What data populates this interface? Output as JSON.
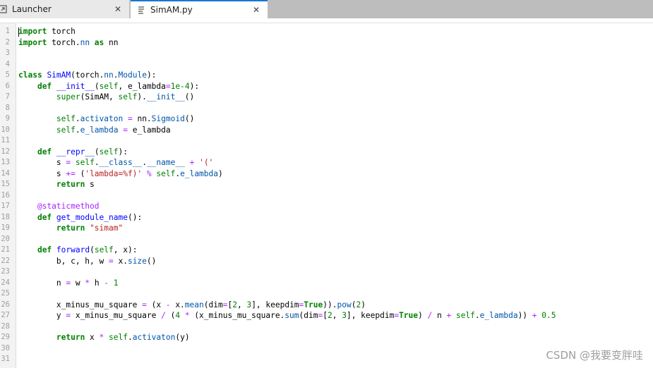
{
  "tabs": [
    {
      "label": "Launcher",
      "icon": "launcher-icon"
    },
    {
      "label": "SimAM.py",
      "icon": "file-text-icon"
    }
  ],
  "close_glyph": "✕",
  "watermark": "CSDN @我要变胖哇",
  "lines": [
    {
      "n": "1",
      "t": [
        [
          "kw",
          "import"
        ],
        [
          "",
          " torch"
        ]
      ]
    },
    {
      "n": "2",
      "t": [
        [
          "kw",
          "import"
        ],
        [
          "",
          " torch."
        ],
        [
          "at",
          "nn"
        ],
        [
          "",
          ""
        ],
        [
          "kw",
          " as"
        ],
        [
          "",
          " nn"
        ]
      ]
    },
    {
      "n": "3",
      "t": []
    },
    {
      "n": "4",
      "t": []
    },
    {
      "n": "5",
      "t": [
        [
          "kw",
          "class"
        ],
        [
          "",
          " "
        ],
        [
          "nm",
          "SimAM"
        ],
        [
          "",
          "(torch."
        ],
        [
          "at",
          "nn"
        ],
        [
          "",
          "."
        ],
        [
          "at",
          "Module"
        ],
        [
          "",
          "):"
        ]
      ]
    },
    {
      "n": "6",
      "t": [
        [
          "",
          "    "
        ],
        [
          "kw",
          "def"
        ],
        [
          "",
          " "
        ],
        [
          "nm",
          "__init__"
        ],
        [
          "",
          "("
        ],
        [
          "bi",
          "self"
        ],
        [
          "",
          ", e_lambda"
        ],
        [
          "op",
          "="
        ],
        [
          "nu",
          "1e-4"
        ],
        [
          "",
          "):"
        ]
      ]
    },
    {
      "n": "7",
      "t": [
        [
          "",
          "        "
        ],
        [
          "bi",
          "super"
        ],
        [
          "",
          "(SimAM, "
        ],
        [
          "bi",
          "self"
        ],
        [
          "",
          ")."
        ],
        [
          "at",
          "__init__"
        ],
        [
          "",
          "()"
        ]
      ]
    },
    {
      "n": "8",
      "t": []
    },
    {
      "n": "9",
      "t": [
        [
          "",
          "        "
        ],
        [
          "bi",
          "self"
        ],
        [
          "",
          "."
        ],
        [
          "at",
          "activaton"
        ],
        [
          "",
          " "
        ],
        [
          "op",
          "="
        ],
        [
          "",
          " nn."
        ],
        [
          "at",
          "Sigmoid"
        ],
        [
          "",
          "()"
        ]
      ]
    },
    {
      "n": "10",
      "t": [
        [
          "",
          "        "
        ],
        [
          "bi",
          "self"
        ],
        [
          "",
          "."
        ],
        [
          "at",
          "e_lambda"
        ],
        [
          "",
          " "
        ],
        [
          "op",
          "="
        ],
        [
          "",
          " e_lambda"
        ]
      ]
    },
    {
      "n": "11",
      "t": []
    },
    {
      "n": "12",
      "t": [
        [
          "",
          "    "
        ],
        [
          "kw",
          "def"
        ],
        [
          "",
          " "
        ],
        [
          "nm",
          "__repr__"
        ],
        [
          "",
          "("
        ],
        [
          "bi",
          "self"
        ],
        [
          "",
          "):"
        ]
      ]
    },
    {
      "n": "13",
      "t": [
        [
          "",
          "        s "
        ],
        [
          "op",
          "="
        ],
        [
          "",
          " "
        ],
        [
          "bi",
          "self"
        ],
        [
          "",
          "."
        ],
        [
          "at",
          "__class__"
        ],
        [
          "",
          "."
        ],
        [
          "at",
          "__name__"
        ],
        [
          "",
          " "
        ],
        [
          "op",
          "+"
        ],
        [
          "",
          " "
        ],
        [
          "st",
          "'('"
        ]
      ]
    },
    {
      "n": "14",
      "t": [
        [
          "",
          "        s "
        ],
        [
          "op",
          "+="
        ],
        [
          "",
          " ("
        ],
        [
          "st",
          "'lambda=%f)'"
        ],
        [
          "",
          " "
        ],
        [
          "op",
          "%"
        ],
        [
          "",
          " "
        ],
        [
          "bi",
          "self"
        ],
        [
          "",
          "."
        ],
        [
          "at",
          "e_lambda"
        ],
        [
          "",
          ")"
        ]
      ]
    },
    {
      "n": "15",
      "t": [
        [
          "",
          "        "
        ],
        [
          "kw",
          "return"
        ],
        [
          "",
          " s"
        ]
      ]
    },
    {
      "n": "16",
      "t": []
    },
    {
      "n": "17",
      "t": [
        [
          "",
          "    "
        ],
        [
          "dec",
          "@staticmethod"
        ]
      ]
    },
    {
      "n": "18",
      "t": [
        [
          "",
          "    "
        ],
        [
          "kw",
          "def"
        ],
        [
          "",
          " "
        ],
        [
          "nm",
          "get_module_name"
        ],
        [
          "",
          "():"
        ]
      ]
    },
    {
      "n": "19",
      "t": [
        [
          "",
          "        "
        ],
        [
          "kw",
          "return"
        ],
        [
          "",
          " "
        ],
        [
          "st",
          "\"simam\""
        ]
      ]
    },
    {
      "n": "20",
      "t": []
    },
    {
      "n": "21",
      "t": [
        [
          "",
          "    "
        ],
        [
          "kw",
          "def"
        ],
        [
          "",
          " "
        ],
        [
          "nm",
          "forward"
        ],
        [
          "",
          "("
        ],
        [
          "bi",
          "self"
        ],
        [
          "",
          ", x):"
        ]
      ]
    },
    {
      "n": "22",
      "t": [
        [
          "",
          "        b, c, h, w "
        ],
        [
          "op",
          "="
        ],
        [
          "",
          " x."
        ],
        [
          "at",
          "size"
        ],
        [
          "",
          "()"
        ]
      ]
    },
    {
      "n": "23",
      "t": []
    },
    {
      "n": "24",
      "t": [
        [
          "",
          "        n "
        ],
        [
          "op",
          "="
        ],
        [
          "",
          " w "
        ],
        [
          "op",
          "*"
        ],
        [
          "",
          " h "
        ],
        [
          "op",
          "-"
        ],
        [
          "",
          " "
        ],
        [
          "nu",
          "1"
        ]
      ]
    },
    {
      "n": "25",
      "t": []
    },
    {
      "n": "26",
      "t": [
        [
          "",
          "        x_minus_mu_square "
        ],
        [
          "op",
          "="
        ],
        [
          "",
          " (x "
        ],
        [
          "op",
          "-"
        ],
        [
          "",
          " x."
        ],
        [
          "at",
          "mean"
        ],
        [
          "",
          "(dim"
        ],
        [
          "op",
          "="
        ],
        [
          "",
          "["
        ],
        [
          "nu",
          "2"
        ],
        [
          "",
          ", "
        ],
        [
          "nu",
          "3"
        ],
        [
          "",
          "], keepdim"
        ],
        [
          "op",
          "="
        ],
        [
          "kw",
          "True"
        ],
        [
          "",
          "))."
        ],
        [
          "at",
          "pow"
        ],
        [
          "",
          "("
        ],
        [
          "nu",
          "2"
        ],
        [
          "",
          ")"
        ]
      ]
    },
    {
      "n": "27",
      "t": [
        [
          "",
          "        y "
        ],
        [
          "op",
          "="
        ],
        [
          "",
          " x_minus_mu_square "
        ],
        [
          "op",
          "/"
        ],
        [
          "",
          " ("
        ],
        [
          "nu",
          "4"
        ],
        [
          "",
          " "
        ],
        [
          "op",
          "*"
        ],
        [
          "",
          " (x_minus_mu_square."
        ],
        [
          "at",
          "sum"
        ],
        [
          "",
          "(dim"
        ],
        [
          "op",
          "="
        ],
        [
          "",
          "["
        ],
        [
          "nu",
          "2"
        ],
        [
          "",
          ", "
        ],
        [
          "nu",
          "3"
        ],
        [
          "",
          "], keepdim"
        ],
        [
          "op",
          "="
        ],
        [
          "kw",
          "True"
        ],
        [
          "",
          ") "
        ],
        [
          "op",
          "/"
        ],
        [
          "",
          " n "
        ],
        [
          "op",
          "+"
        ],
        [
          "",
          " "
        ],
        [
          "bi",
          "self"
        ],
        [
          "",
          "."
        ],
        [
          "at",
          "e_lambda"
        ],
        [
          "",
          ")) "
        ],
        [
          "op",
          "+"
        ],
        [
          "",
          " "
        ],
        [
          "nu",
          "0.5"
        ]
      ]
    },
    {
      "n": "28",
      "t": []
    },
    {
      "n": "29",
      "t": [
        [
          "",
          "        "
        ],
        [
          "kw",
          "return"
        ],
        [
          "",
          " x "
        ],
        [
          "op",
          "*"
        ],
        [
          "",
          " "
        ],
        [
          "bi",
          "self"
        ],
        [
          "",
          "."
        ],
        [
          "at",
          "activaton"
        ],
        [
          "",
          "(y)"
        ]
      ]
    },
    {
      "n": "30",
      "t": []
    },
    {
      "n": "31",
      "t": []
    }
  ]
}
